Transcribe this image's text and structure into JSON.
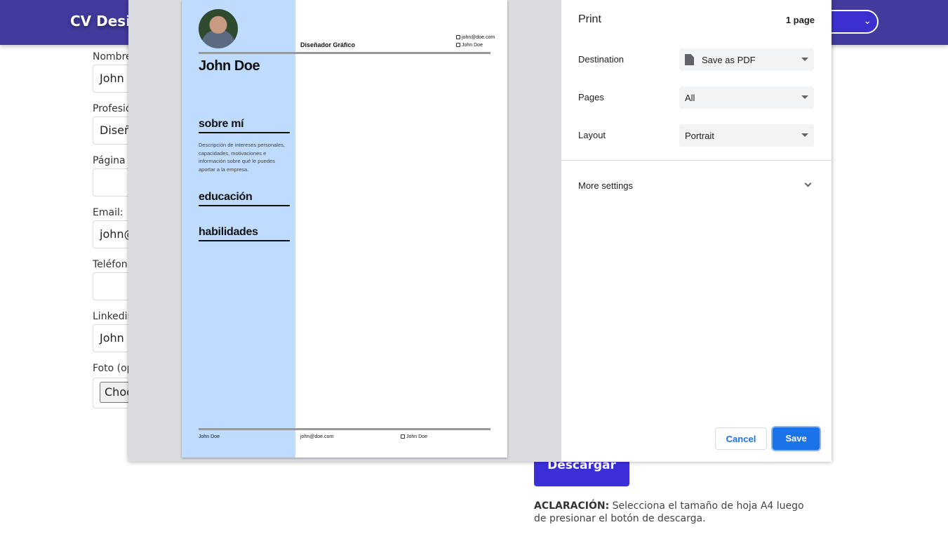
{
  "app": {
    "brand": "CV Desig",
    "template_select": ""
  },
  "form": {
    "labels": [
      "Nombre",
      "Profesió",
      "Página",
      "Email:",
      "Teléfon",
      "Linkedin",
      "Foto (op"
    ],
    "values": [
      "John",
      "Diseñ",
      "",
      "john@",
      "",
      "John"
    ],
    "file_button": "Choo"
  },
  "download": {
    "label": "Descargar",
    "note_bold": "ACLARACIÓN:",
    "note_text": "Selecciona el tamaño de hoja A4 luego de presionar el botón de descarga."
  },
  "cv": {
    "name": "John Doe",
    "job": "Diseñador Gráfico",
    "email": "john@doe.com",
    "linkedin": "John Doe",
    "sections": [
      "sobre mí",
      "educación",
      "habilidades"
    ],
    "about": "Descripción de intereses personales, capacidades, motivaciones e información sobre qué le puedes aportar a la empresa.",
    "footer": [
      "John Doe",
      "john@doe.com",
      "John Doe"
    ]
  },
  "print": {
    "title": "Print",
    "page_count": "1 page",
    "destination_label": "Destination",
    "destination_value": "Save as PDF",
    "pages_label": "Pages",
    "pages_value": "All",
    "layout_label": "Layout",
    "layout_value": "Portrait",
    "more_settings": "More settings",
    "cancel": "Cancel",
    "save": "Save"
  },
  "colors": {
    "header_bg": "#423b9c",
    "accent": "#3b2fd8",
    "cv_sidebar": "#bfdbfe",
    "print_primary": "#1a73e8"
  }
}
